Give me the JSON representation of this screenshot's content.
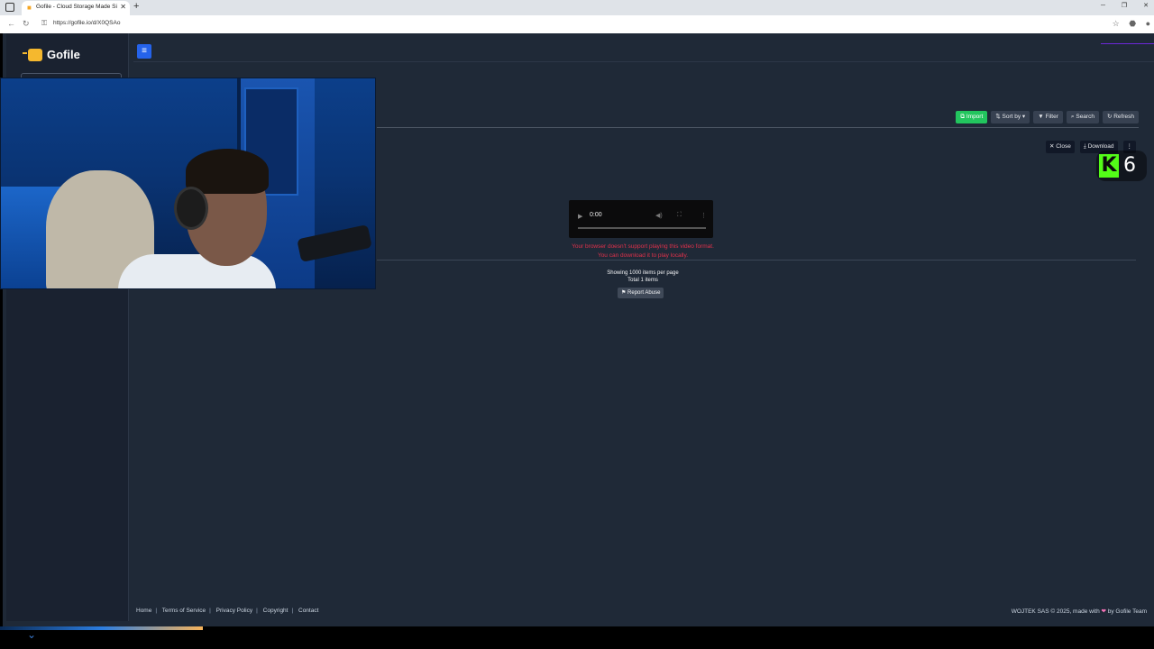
{
  "browser": {
    "tab_title": "Gofile - Cloud Storage Made Simple",
    "url": "https://gofile.io/d/X0QSAo",
    "new_tab_icon": "plus-icon"
  },
  "app": {
    "brand": "Gofile",
    "brand_color": "#f5b82e",
    "accent_color": "#2563eb",
    "toolbar": {
      "import": "Import",
      "sort_by": "Sort by",
      "filter": "Filter",
      "search": "Search",
      "refresh": "Refresh"
    },
    "file_actions": {
      "close": "Close",
      "download": "Download"
    },
    "video": {
      "time": "0:00"
    },
    "error": {
      "line1": "Your browser doesn't support playing this video format.",
      "line2": "You can download it to play locally."
    },
    "pagination": {
      "per_page": "Showing 1000 items per page",
      "total": "Total 1 items"
    },
    "report_abuse": "Report Abuse",
    "footer": {
      "links": [
        "Home",
        "Terms of Service",
        "Privacy Policy",
        "Copyright",
        "Contact"
      ],
      "copyright_prefix": "WOJTEK SAS © 2025, made with",
      "copyright_suffix": "by Gofile Team"
    }
  },
  "overlay": {
    "kick_letter": "K",
    "kick_count": "6",
    "kick_color": "#53fc18"
  }
}
